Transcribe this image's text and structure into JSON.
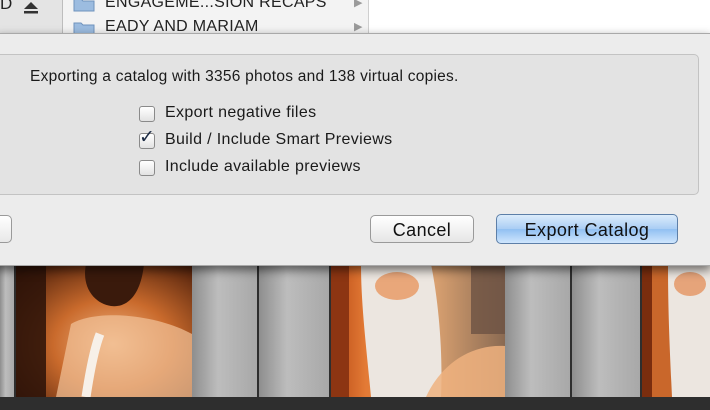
{
  "background": {
    "top_left": {
      "letter": "D"
    },
    "folders": [
      {
        "name": "ENGAGEME...SION RECAPS"
      },
      {
        "name": "EADY AND MARIAM"
      }
    ]
  },
  "dialog": {
    "message": "Exporting a catalog with 3356 photos and 138 virtual copies.",
    "options": [
      {
        "label": "Export negative files",
        "checked": false
      },
      {
        "label": "Build / Include Smart Previews",
        "checked": true
      },
      {
        "label": "Include available previews",
        "checked": false
      }
    ],
    "buttons": {
      "cancel": "Cancel",
      "export": "Export Catalog"
    }
  },
  "colors": {
    "dialog_bg": "#ececec",
    "primary_button": "#a9cdf4",
    "filmstrip": "#3a3a3a"
  }
}
